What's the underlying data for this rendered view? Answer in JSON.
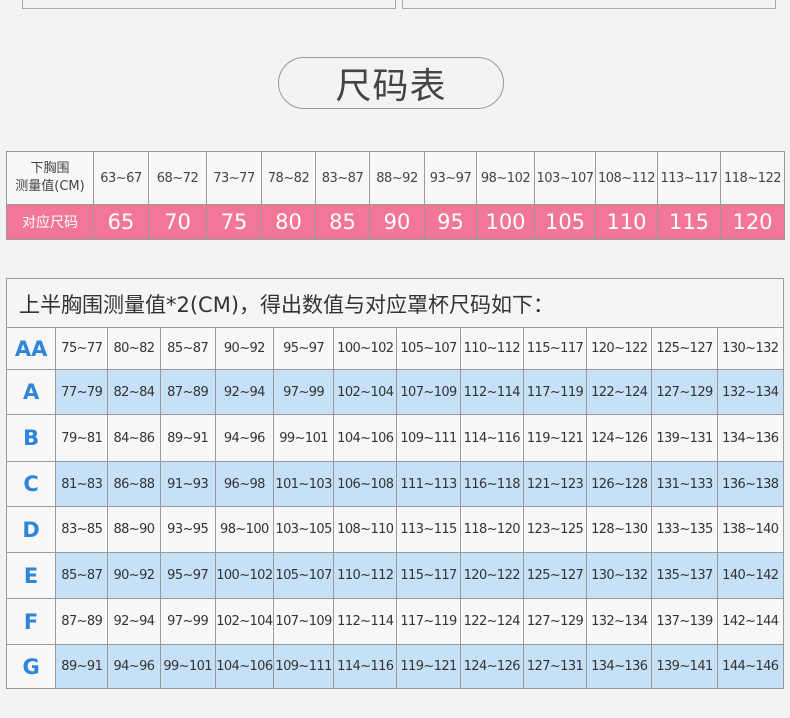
{
  "title": "尺码表",
  "size_table": {
    "header_label": [
      "下胸围",
      "测量值(CM)"
    ],
    "ranges": [
      "63~67",
      "68~72",
      "73~77",
      "78~82",
      "83~87",
      "88~92",
      "93~97",
      "98~102",
      "103~107",
      "108~112",
      "113~117",
      "118~122"
    ],
    "size_label": "对应尺码",
    "sizes": [
      "65",
      "70",
      "75",
      "80",
      "85",
      "90",
      "95",
      "100",
      "105",
      "110",
      "115",
      "120"
    ]
  },
  "cup_table": {
    "heading": "上半胸围测量值*2(CM)，得出数值与对应罩杯尺码如下：",
    "rows": [
      {
        "cup": "AA",
        "values": [
          "75~77",
          "80~82",
          "85~87",
          "90~92",
          "95~97",
          "100~102",
          "105~107",
          "110~112",
          "115~117",
          "120~122",
          "125~127",
          "130~132"
        ]
      },
      {
        "cup": "A",
        "values": [
          "77~79",
          "82~84",
          "87~89",
          "92~94",
          "97~99",
          "102~104",
          "107~109",
          "112~114",
          "117~119",
          "122~124",
          "127~129",
          "132~134"
        ]
      },
      {
        "cup": "B",
        "values": [
          "79~81",
          "84~86",
          "89~91",
          "94~96",
          "99~101",
          "104~106",
          "109~111",
          "114~116",
          "119~121",
          "124~126",
          "139~131",
          "134~136"
        ]
      },
      {
        "cup": "C",
        "values": [
          "81~83",
          "86~88",
          "91~93",
          "96~98",
          "101~103",
          "106~108",
          "111~113",
          "116~118",
          "121~123",
          "126~128",
          "131~133",
          "136~138"
        ]
      },
      {
        "cup": "D",
        "values": [
          "83~85",
          "88~90",
          "93~95",
          "98~100",
          "103~105",
          "108~110",
          "113~115",
          "118~120",
          "123~125",
          "128~130",
          "133~135",
          "138~140"
        ]
      },
      {
        "cup": "E",
        "values": [
          "85~87",
          "90~92",
          "95~97",
          "100~102",
          "105~107",
          "110~112",
          "115~117",
          "120~122",
          "125~127",
          "130~132",
          "135~137",
          "140~142"
        ]
      },
      {
        "cup": "F",
        "values": [
          "87~89",
          "92~94",
          "97~99",
          "102~104",
          "107~109",
          "112~114",
          "117~119",
          "122~124",
          "127~129",
          "132~134",
          "137~139",
          "142~144"
        ]
      },
      {
        "cup": "G",
        "values": [
          "89~91",
          "94~96",
          "99~101",
          "104~106",
          "109~111",
          "114~116",
          "119~121",
          "124~126",
          "127~131",
          "134~136",
          "139~141",
          "144~146"
        ]
      }
    ]
  },
  "colors": {
    "size_row": "#f27796",
    "cup_letter": "#2f86d8",
    "highlight_row": "#c5e0f7"
  }
}
